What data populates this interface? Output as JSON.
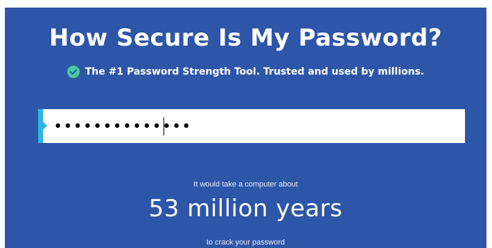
{
  "header": {
    "title": "How Secure Is My Password?",
    "subtitle": "The #1 Password Strength Tool. Trusted and used by millions.",
    "check_icon": "check-circle-icon",
    "check_color": "#48c9a0"
  },
  "password": {
    "value": "••••••••••••••",
    "accent_color": "#2bb6e3"
  },
  "result": {
    "intro": "It would take a computer about",
    "time": "53 million years",
    "outro": "to crack your password"
  },
  "colors": {
    "background": "#2e56a8",
    "text": "#ffffff"
  }
}
